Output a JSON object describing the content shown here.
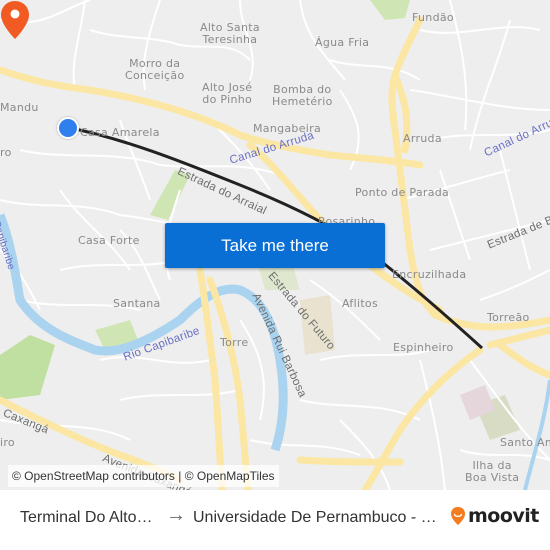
{
  "map": {
    "neighborhoods": [
      {
        "id": "fundao",
        "label": "Fundão"
      },
      {
        "id": "alto-santa-teresinha",
        "label": "Alto Santa\nTeresinha"
      },
      {
        "id": "agua-fria",
        "label": "Água Fria"
      },
      {
        "id": "morro-da-conceicao",
        "label": "Morro da\nConceição"
      },
      {
        "id": "alto-jose-do-pinho",
        "label": "Alto José\ndo Pinho"
      },
      {
        "id": "bomba-do-hemeterio",
        "label": "Bomba do\nHemetério"
      },
      {
        "id": "mandu",
        "label": "Mandu"
      },
      {
        "id": "casa-amarela",
        "label": "Casa Amarela"
      },
      {
        "id": "mangabeira",
        "label": "Mangabeira"
      },
      {
        "id": "arruda",
        "label": "Arruda"
      },
      {
        "id": "ponto-de-parada",
        "label": "Ponto de Parada"
      },
      {
        "id": "rosarinho",
        "label": "Rosarinho"
      },
      {
        "id": "casa-forte",
        "label": "Casa Forte"
      },
      {
        "id": "encruzilhada",
        "label": "Encruzilhada"
      },
      {
        "id": "santana",
        "label": "Santana"
      },
      {
        "id": "aflitos",
        "label": "Aflitos"
      },
      {
        "id": "torreao",
        "label": "Torreão"
      },
      {
        "id": "torre",
        "label": "Torre"
      },
      {
        "id": "espinheiro",
        "label": "Espinheiro"
      },
      {
        "id": "santo-amaro",
        "label": "Santo Am"
      },
      {
        "id": "ilha-da-boa-vista",
        "label": "Ilha da\nBoa Vista"
      },
      {
        "id": "parnamirim-edge",
        "label": "iro"
      },
      {
        "id": "monteiro-edge",
        "label": "ro"
      }
    ],
    "roads": [
      {
        "id": "canal-do-arruda-1",
        "label": "Canal do Arruda"
      },
      {
        "id": "canal-do-arruda-2",
        "label": "Canal do Arruda"
      },
      {
        "id": "estrada-do-arraial",
        "label": "Estrada do Arraial"
      },
      {
        "id": "estrada-de-belem",
        "label": "Estrada de B"
      },
      {
        "id": "estrada-do-futuro",
        "label": "Estrada do Futuro"
      },
      {
        "id": "avenida-rui-barbosa",
        "label": "Avenida Rui Barbosa"
      },
      {
        "id": "rio-capibaribe-1",
        "label": "Rio Capibaribe"
      },
      {
        "id": "rio-capibaribe-2",
        "label": "Capibaribe"
      },
      {
        "id": "avenida-caxanga",
        "label": "a Caxangá"
      },
      {
        "id": "avenida-caxanga-2",
        "label": "Avenida Caxangá"
      }
    ],
    "cta_label": "Take me there",
    "attribution": {
      "osm": "© OpenStreetMap contributors",
      "separator": "|",
      "omt": "© OpenMapTiles"
    },
    "colors": {
      "route": "#222222",
      "origin": "#2f80ed",
      "destination": "#f15a22",
      "cta": "#0a6fd4",
      "major_road": "#fbe7a3",
      "water": "#aad3f0",
      "park": "#c8e6a8"
    }
  },
  "footer": {
    "from": "Terminal Do Alto…",
    "arrow_icon": "→",
    "to": "Universidade De Pernambuco - …",
    "brand": "moovit"
  }
}
